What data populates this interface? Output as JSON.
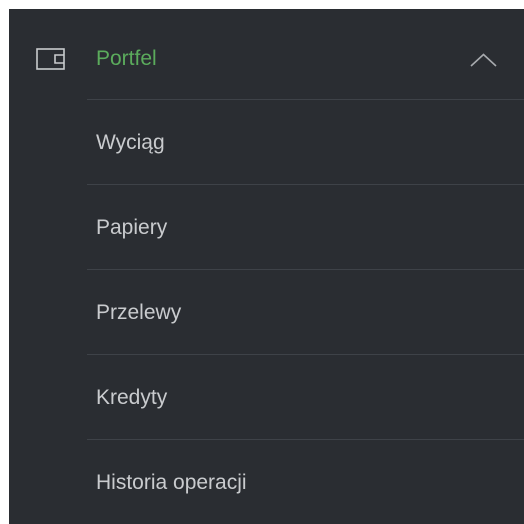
{
  "menu": {
    "section": {
      "label": "Portfel",
      "icon": "wallet-icon",
      "toggle_icon": "chevron-up-icon",
      "expanded": true,
      "accent_color": "#5bab5c"
    },
    "items": [
      {
        "label": "Wyciąg"
      },
      {
        "label": "Papiery"
      },
      {
        "label": "Przelewy"
      },
      {
        "label": "Kredyty"
      },
      {
        "label": "Historia operacji"
      }
    ],
    "colors": {
      "background": "#2a2d32",
      "item_text": "#c9cbce",
      "divider": "#3e4248"
    }
  }
}
